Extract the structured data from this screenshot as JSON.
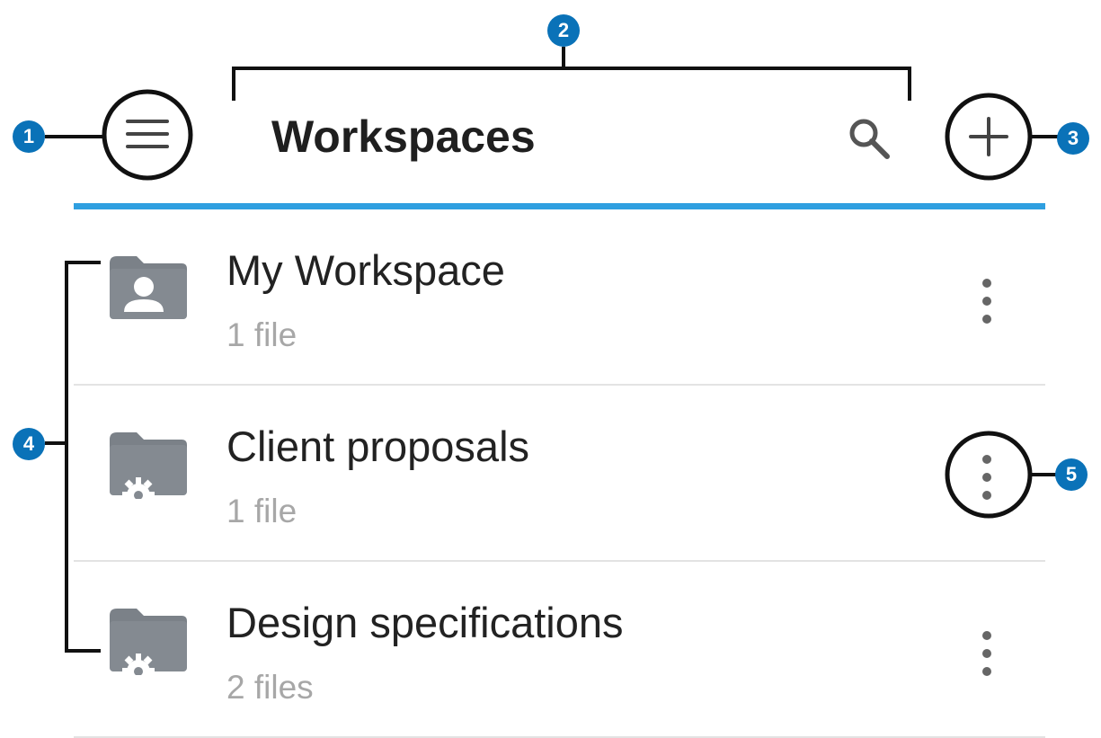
{
  "header": {
    "title": "Workspaces",
    "menu_icon": "hamburger-menu-icon",
    "search_icon": "search-icon",
    "add_icon": "plus-icon"
  },
  "workspaces": [
    {
      "name": "My Workspace",
      "count": "1 file",
      "icon": "personal-folder-icon"
    },
    {
      "name": "Client proposals",
      "count": "1 file",
      "icon": "shared-folder-icon"
    },
    {
      "name": "Design specifications",
      "count": "2 files",
      "icon": "shared-folder-icon"
    }
  ],
  "callouts": [
    "1",
    "2",
    "3",
    "4",
    "5"
  ],
  "colors": {
    "accent_line": "#2f9fe0",
    "callout_badge": "#0a72b8",
    "icon_gray": "#7b8188",
    "subtitle_gray": "#a7a7a7"
  }
}
